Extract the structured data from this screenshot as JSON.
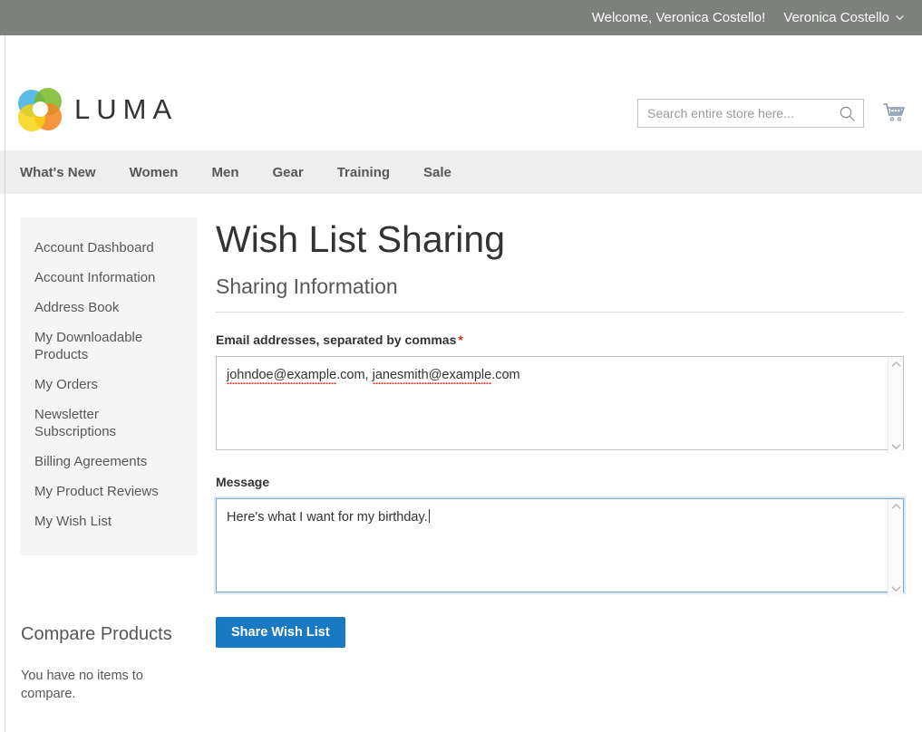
{
  "top_panel": {
    "welcome": "Welcome, Veronica Costello!",
    "customer_name": "Veronica Costello",
    "chevron_icon": "chevron-down-icon"
  },
  "header": {
    "logo_text": "LUMA",
    "logo_icon": "luma-logo-icon",
    "search": {
      "placeholder": "Search entire store here...",
      "value": "",
      "icon": "search-icon"
    },
    "cart_icon": "shopping-cart-icon"
  },
  "nav": {
    "items": [
      {
        "label": "What's New"
      },
      {
        "label": "Women"
      },
      {
        "label": "Men"
      },
      {
        "label": "Gear"
      },
      {
        "label": "Training"
      },
      {
        "label": "Sale"
      }
    ]
  },
  "sidebar": {
    "items": [
      {
        "label": "Account Dashboard"
      },
      {
        "label": "Account Information"
      },
      {
        "label": "Address Book"
      },
      {
        "label": "My Downloadable Products"
      },
      {
        "label": "My Orders"
      },
      {
        "label": "Newsletter Subscriptions"
      },
      {
        "label": "Billing Agreements"
      },
      {
        "label": "My Product Reviews"
      },
      {
        "label": "My Wish List"
      }
    ],
    "compare": {
      "title": "Compare Products",
      "empty_text": "You have no items to compare."
    }
  },
  "main": {
    "page_title": "Wish List Sharing",
    "legend": "Sharing Information",
    "email_field": {
      "label": "Email addresses, separated by commas",
      "required_marker": "*",
      "value_part1": "johndoe",
      "value_part2": "@example",
      "value_part3": ".com, ",
      "value_part4": "janesmith",
      "value_part5": "@example",
      "value_part6": ".com"
    },
    "message_field": {
      "label": "Message",
      "value": "Here's what I want for my birthday."
    },
    "submit_label": "Share Wish List"
  },
  "colors": {
    "top_panel_bg": "#7d807d",
    "nav_bg": "#eeeeee",
    "sidebar_bg": "#f5f5f5",
    "primary_button": "#1979c3",
    "required_star": "#e02b27",
    "focus_border": "#7fa7cb"
  }
}
